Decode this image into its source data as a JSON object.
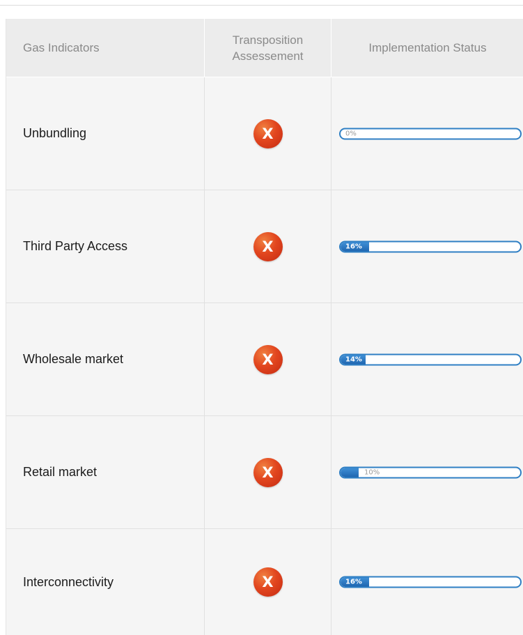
{
  "table": {
    "headers": {
      "indicators": "Gas Indicators",
      "assessment_line1": "Transposition",
      "assessment_line2": "Assessement",
      "status": "Implementation Status"
    },
    "rows": [
      {
        "indicator": "Unbundling",
        "assessment_icon": "x-icon",
        "assessment_symbol": "X",
        "progress_label": "0%",
        "progress_value": 0
      },
      {
        "indicator": "Third Party Access",
        "assessment_icon": "x-icon",
        "assessment_symbol": "X",
        "progress_label": "16%",
        "progress_value": 16
      },
      {
        "indicator": "Wholesale market",
        "assessment_icon": "x-icon",
        "assessment_symbol": "X",
        "progress_label": "14%",
        "progress_value": 14
      },
      {
        "indicator": "Retail market",
        "assessment_icon": "x-icon",
        "assessment_symbol": "X",
        "progress_label": "10%",
        "progress_value": 10
      },
      {
        "indicator": "Interconnectivity",
        "assessment_icon": "x-icon",
        "assessment_symbol": "X",
        "progress_label": "16%",
        "progress_value": 16
      }
    ]
  },
  "colors": {
    "header_bg": "#ececec",
    "row_bg": "#f5f5f5",
    "progress_blue": "#2f7fc4",
    "fail_red": "#e2461f"
  }
}
